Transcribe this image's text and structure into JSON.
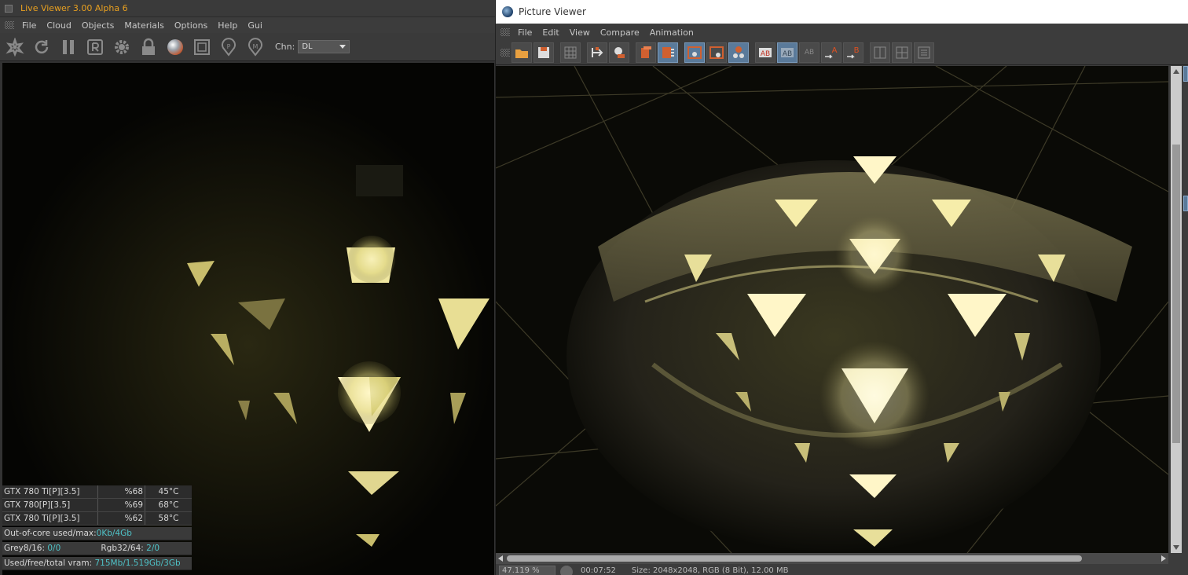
{
  "live_viewer": {
    "title": "Live Viewer 3.00 Alpha 6",
    "menu": [
      "File",
      "Cloud",
      "Objects",
      "Materials",
      "Options",
      "Help",
      "Gui"
    ],
    "toolbar_icons": [
      "settings-cog-icon",
      "refresh-icon",
      "pause-icon",
      "r-box-icon",
      "gear-icon",
      "lock-icon",
      "material-sphere-icon",
      "region-square-icon",
      "pick-p-icon",
      "pick-m-icon"
    ],
    "channel_label": "Chn:",
    "channel_value": "DL",
    "gpus": [
      {
        "name": "GTX 780 Ti[P][3.5]",
        "util": "%68",
        "temp": "45°C"
      },
      {
        "name": "GTX 780[P][3.5]",
        "util": "%69",
        "temp": "68°C"
      },
      {
        "name": "GTX 780 Ti[P][3.5]",
        "util": "%62",
        "temp": "58°C"
      }
    ],
    "out_of_core_label": "Out-of-core used/max:",
    "out_of_core_value": "0Kb/4Gb",
    "grey_label": "Grey8/16:",
    "grey_value": "0/0",
    "rgb_label": "Rgb32/64:",
    "rgb_value": "2/0",
    "vram_label": "Used/free/total vram:",
    "vram_value": "715Mb/1.519Gb/3Gb"
  },
  "picture_viewer": {
    "title": "Picture Viewer",
    "menu": [
      "File",
      "Edit",
      "View",
      "Compare",
      "Animation"
    ],
    "status_zoom": "47.119 %",
    "status_time": "00:07:52",
    "status_size": "Size: 2048x2048, RGB (8 Bit), 12.00 MB"
  },
  "colors": {
    "accent_title": "#e8a020",
    "stat_value": "#4fc3c8",
    "render_glow": "#f6f0b8"
  }
}
